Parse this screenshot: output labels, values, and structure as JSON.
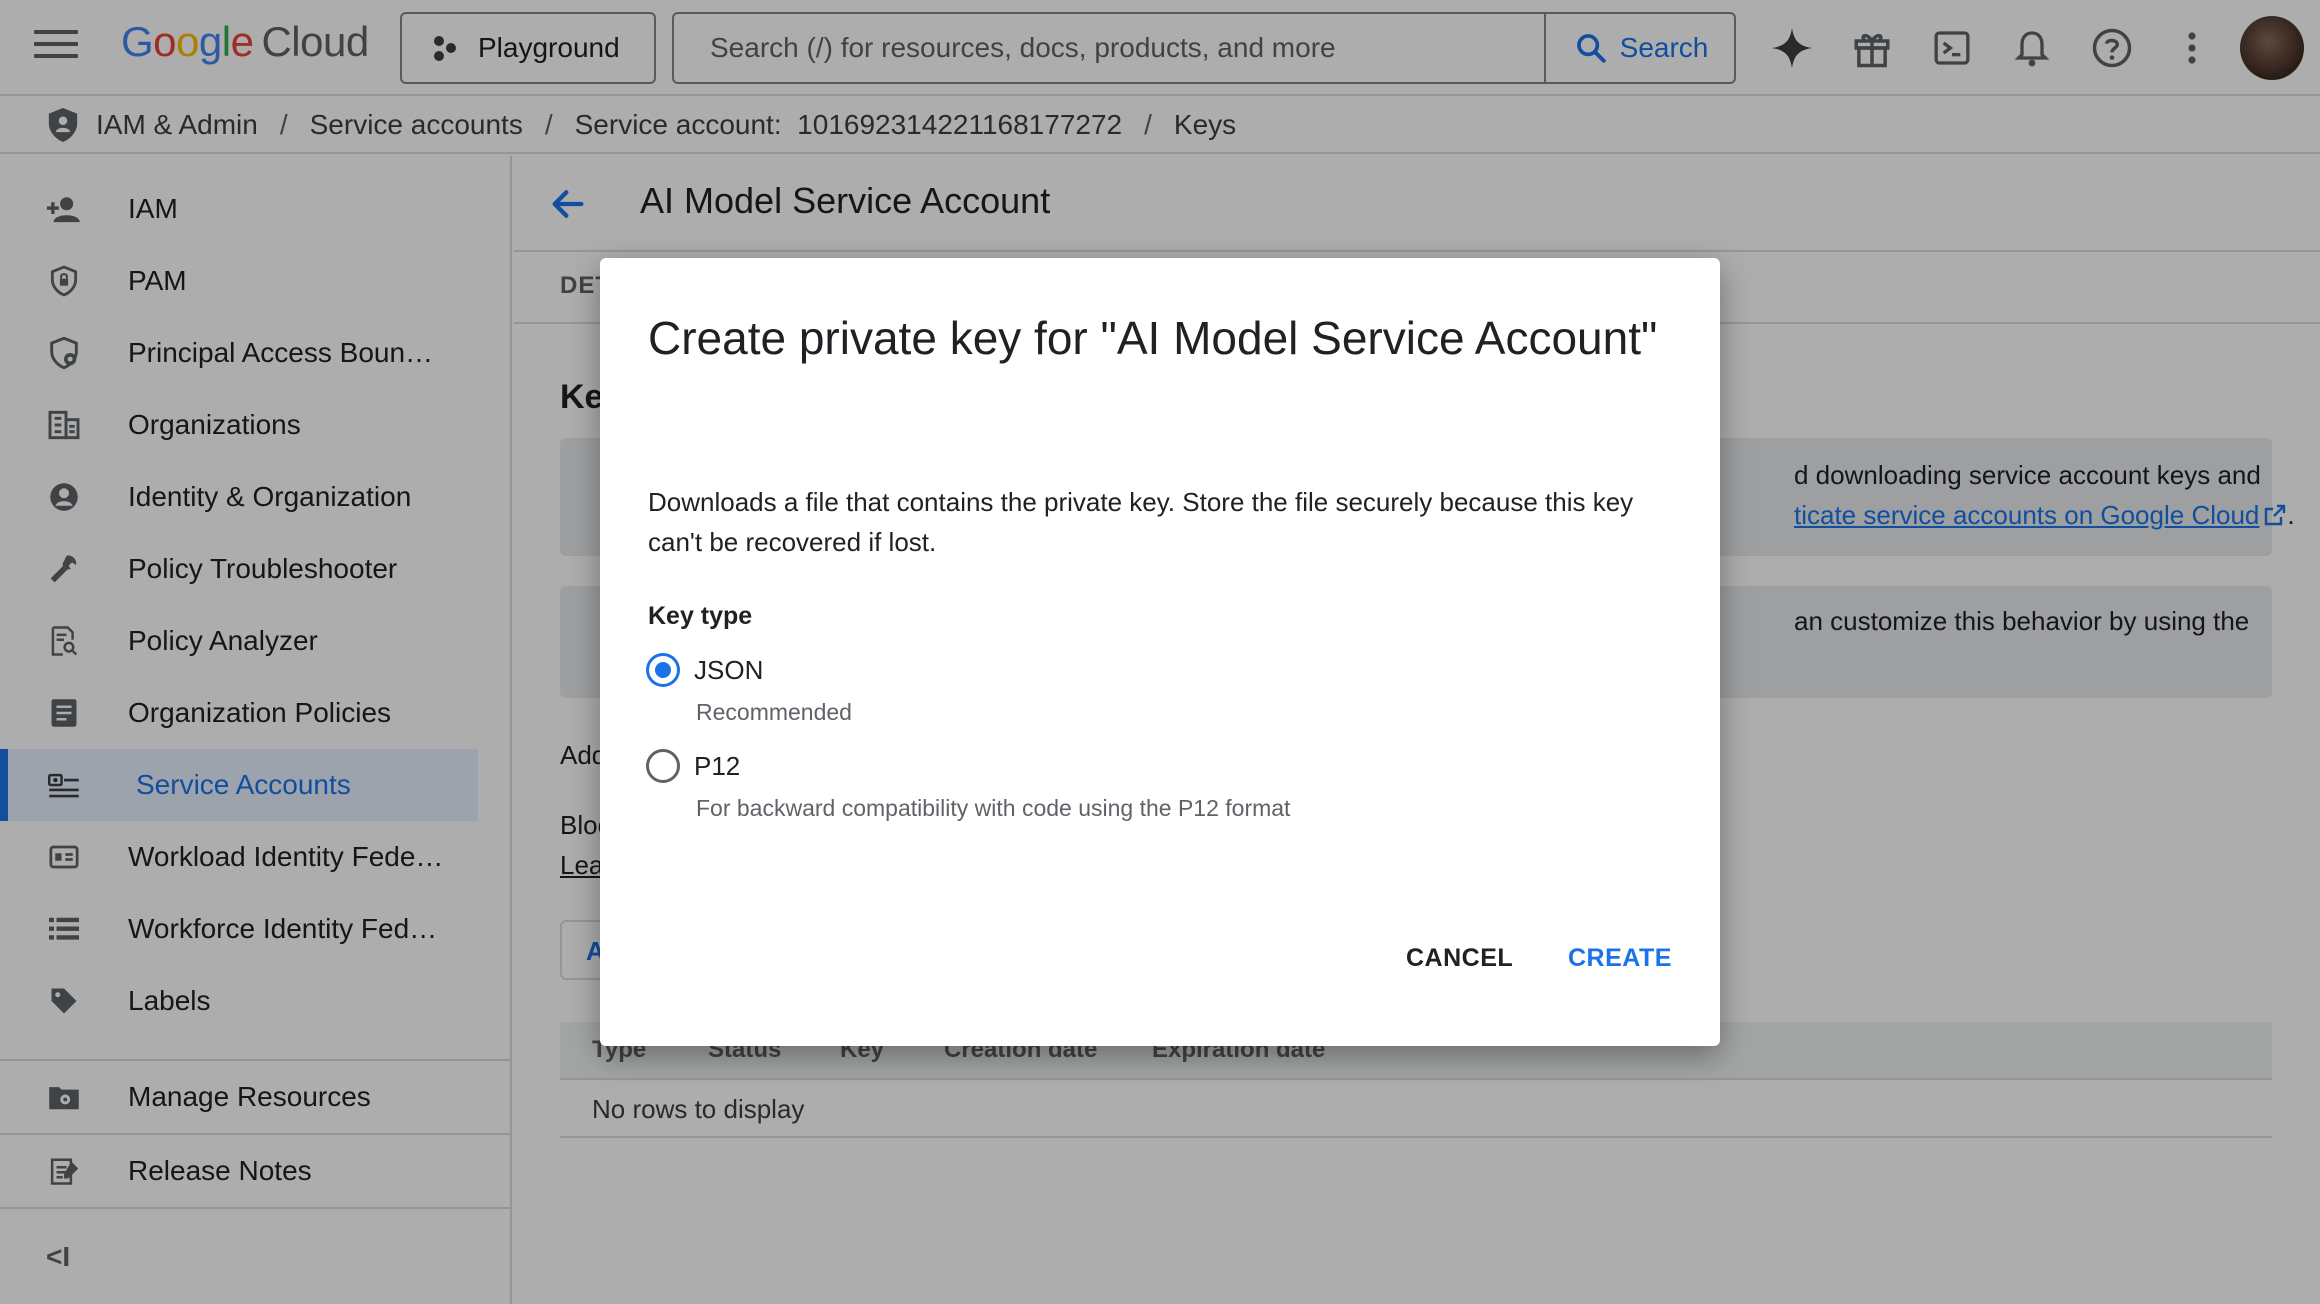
{
  "topbar": {
    "logo_g": "G",
    "logo_o1": "o",
    "logo_o2": "o",
    "logo_g2": "g",
    "logo_l": "l",
    "logo_e": "e",
    "logo_cloud": "Cloud",
    "project_label": "Playground",
    "search_placeholder": "Search (/) for resources, docs, products, and more",
    "search_button": "Search"
  },
  "breadcrumb": {
    "items": [
      "IAM & Admin",
      "Service accounts",
      "Service account:  101692314221168177272",
      "Keys"
    ],
    "separator": "/"
  },
  "sidebar": {
    "items": [
      {
        "label": "IAM",
        "icon": "person-add-icon"
      },
      {
        "label": "PAM",
        "icon": "shield-lock-icon"
      },
      {
        "label": "Principal Access Boun…",
        "icon": "shield-policy-icon"
      },
      {
        "label": "Organizations",
        "icon": "building-icon"
      },
      {
        "label": "Identity & Organization",
        "icon": "account-circle-icon"
      },
      {
        "label": "Policy Troubleshooter",
        "icon": "wrench-icon"
      },
      {
        "label": "Policy Analyzer",
        "icon": "document-search-icon"
      },
      {
        "label": "Organization Policies",
        "icon": "list-document-icon"
      },
      {
        "label": "Service Accounts",
        "icon": "service-account-icon",
        "active": true
      },
      {
        "label": "Workload Identity Fede…",
        "icon": "id-card-icon"
      },
      {
        "label": "Workforce Identity Fed…",
        "icon": "list-icon"
      },
      {
        "label": "Labels",
        "icon": "tag-icon"
      }
    ],
    "footer_items": [
      {
        "label": "Manage Resources",
        "icon": "folder-settings-icon"
      },
      {
        "label": "Release Notes",
        "icon": "release-notes-icon"
      }
    ],
    "collapse_label": "<I"
  },
  "main": {
    "title": "AI Model Service Account",
    "tab_partial": "DET",
    "heading_partial": "Ke",
    "info1_line1": "d downloading service account keys and",
    "info1_link": "ticate service accounts on Google Cloud",
    "info1_end": ".",
    "info2_line1": "an customize this behavior by using the",
    "add_text_partial": "Add",
    "block_text_partial": "Bloc",
    "learn_partial": "Lea",
    "add_key_partial": "A",
    "table": {
      "headers": [
        "Type",
        "Status",
        "Key",
        "Creation date",
        "Expiration date"
      ],
      "empty": "No rows to display"
    }
  },
  "dialog": {
    "title": "Create private key for \"AI Model Service Account\"",
    "description": "Downloads a file that contains the private key. Store the file securely because this key can't be recovered if lost.",
    "key_type_label": "Key type",
    "options": [
      {
        "label": "JSON",
        "hint": "Recommended",
        "checked": true
      },
      {
        "label": "P12",
        "hint": "For backward compatibility with code using the P12 format",
        "checked": false
      }
    ],
    "cancel": "CANCEL",
    "create": "CREATE"
  },
  "colors": {
    "accent": "#1a73e8",
    "scrim": "rgba(0,0,0,0.32)",
    "active_nav_bg": "#e8f0fe"
  }
}
